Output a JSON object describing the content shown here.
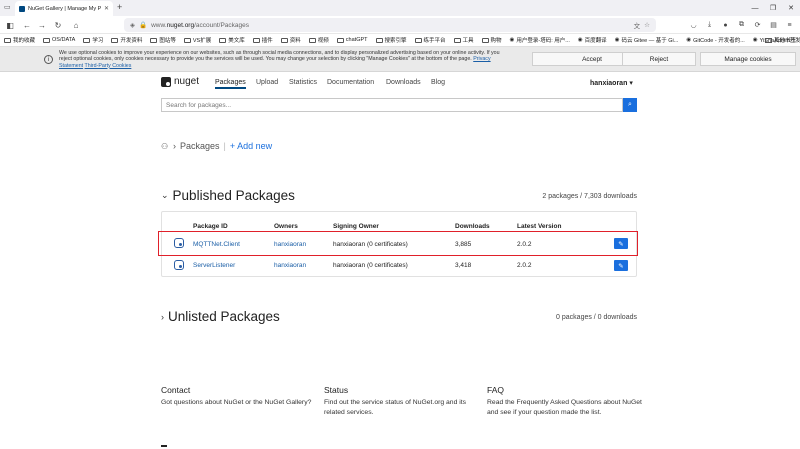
{
  "browser": {
    "tab_title": "NuGet Gallery | Manage My P",
    "url_prefix": "www.",
    "url_domain": "nuget.org",
    "url_path": "/account/Packages",
    "bookmarks": [
      "我的收藏",
      "OS/DATA",
      "学习",
      "开发资料",
      "图站等",
      "VS扩展",
      "美文库",
      "插件",
      "资料",
      "视频",
      "chatGPT",
      "搜索引擎",
      "练手平台",
      "工具",
      "购物",
      "用户登录-塔码: 用户...",
      "百度翻译",
      "码云 Gitee — 基于 Gi...",
      "GitCode - 开发者的...",
      "YiShaAdmin开发文档"
    ],
    "bookmark_other": "其他书签"
  },
  "cookie": {
    "message": "We use optional cookies to improve your experience on our websites, such as through social media connections, and to display personalized advertising based on your online activity. If you reject optional cookies, only cookies necessary to provide you the services will be used. You may change your selection by clicking \"Manage Cookies\" at the bottom of the page.",
    "privacy_link": "Privacy Statement",
    "third_party_link": "Third-Party Cookies",
    "accept": "Accept",
    "reject": "Reject",
    "manage": "Manage cookies"
  },
  "header": {
    "logo_text": "nuget",
    "menu": [
      "Packages",
      "Upload",
      "Statistics",
      "Documentation",
      "Downloads",
      "Blog"
    ],
    "user": "hanxiaoran",
    "search_placeholder": "Search for packages..."
  },
  "breadcrumb": {
    "current": "Packages",
    "add": "+ Add new"
  },
  "published": {
    "title": "Published Packages",
    "stats": "2 packages / 7,303 downloads",
    "columns": [
      "Package ID",
      "Owners",
      "Signing Owner",
      "Downloads",
      "Latest Version"
    ],
    "rows": [
      {
        "id": "MQTTNet.Client",
        "owner": "hanxiaoran",
        "signing": "hanxiaoran (0 certificates)",
        "downloads": "3,885",
        "version": "2.0.2"
      },
      {
        "id": "ServerListener",
        "owner": "hanxiaoran",
        "signing": "hanxiaoran (0 certificates)",
        "downloads": "3,418",
        "version": "2.0.2"
      }
    ]
  },
  "unlisted": {
    "title": "Unlisted Packages",
    "stats": "0 packages / 0 downloads"
  },
  "footer": {
    "contact_title": "Contact",
    "contact_text": "Got questions about NuGet or the NuGet Gallery?",
    "status_title": "Status",
    "status_text": "Find out the service status of NuGet.org and its related services.",
    "faq_title": "FAQ",
    "faq_text": "Read the Frequently Asked Questions about NuGet and see if your question made the list."
  },
  "colors": {
    "accent": "#1a6fde",
    "highlight": "#e0202a",
    "link": "#1a5ea6"
  }
}
